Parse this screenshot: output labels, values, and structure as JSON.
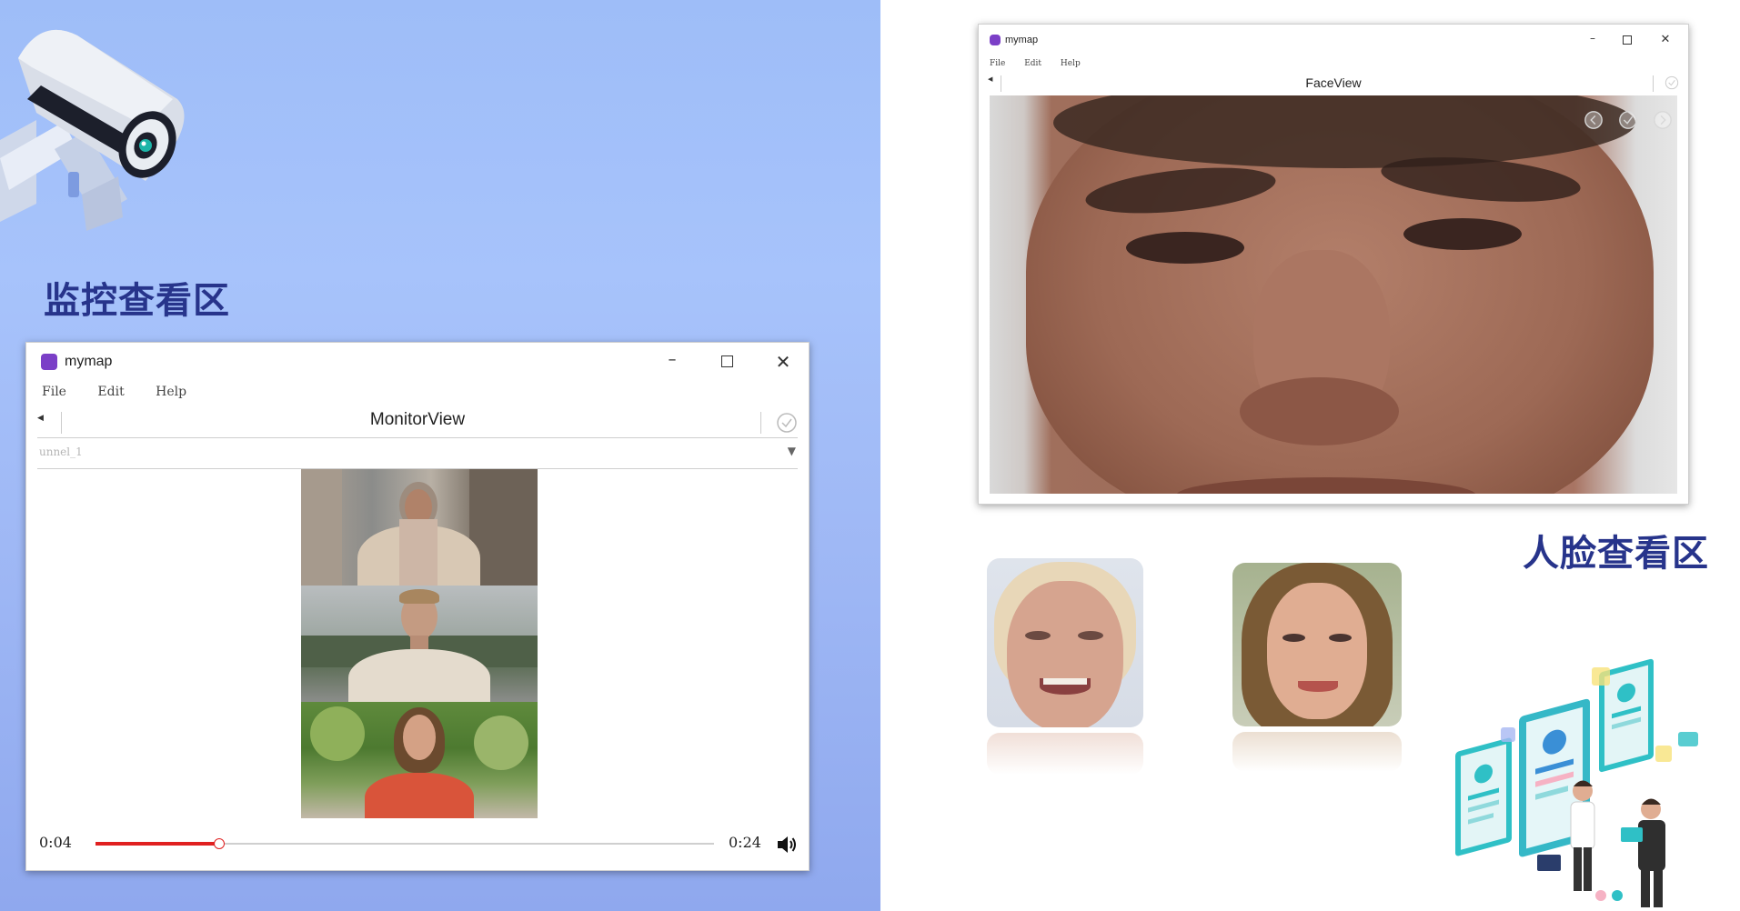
{
  "monitor_section": {
    "title": "监控查看区"
  },
  "face_section": {
    "title": "人脸查看区"
  },
  "monitor_window": {
    "app_name": "mymap",
    "view_title": "MonitorView",
    "menu": [
      "File",
      "Edit",
      "Help"
    ],
    "channel_value": "unnel_1",
    "current_time": "0:04",
    "total_time": "0:24",
    "progress": 0.2
  },
  "face_window": {
    "app_name": "mymap",
    "view_title": "FaceView",
    "menu": [
      "File",
      "Edit",
      "Help"
    ]
  },
  "icons": {
    "window_controls": [
      "minimize-icon",
      "maximize-icon",
      "close-icon"
    ],
    "status": "check-circle-icon",
    "volume": "volume-icon"
  },
  "colors": {
    "accent_title": "#27348b",
    "progress": "#e02020",
    "logo": "#7b3fc7"
  }
}
